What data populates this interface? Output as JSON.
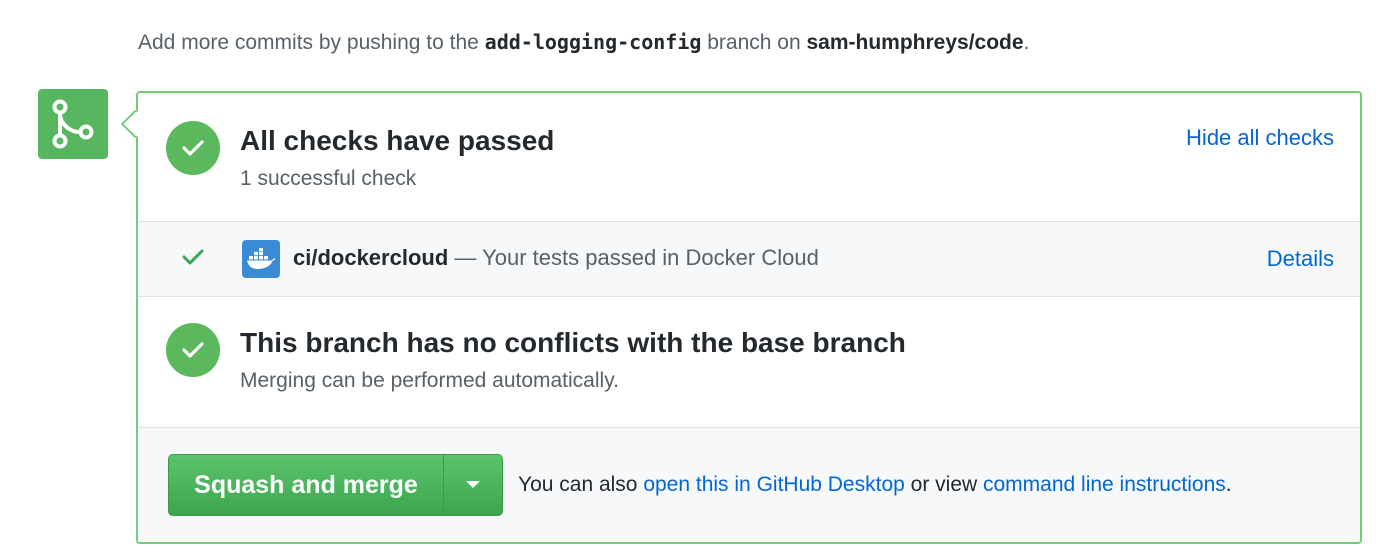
{
  "hint": {
    "prefix": "Add more commits by pushing to the ",
    "branch": "add-logging-config",
    "middle": " branch on ",
    "repo": "sam-humphreys/code",
    "suffix": "."
  },
  "checks": {
    "title": "All checks have passed",
    "subtitle": "1 successful check",
    "toggle_label": "Hide all checks",
    "items": [
      {
        "context": "ci/dockercloud",
        "separator": " — ",
        "description": "Your tests passed in Docker Cloud",
        "details_label": "Details",
        "icon": "docker-logo-icon"
      }
    ]
  },
  "conflicts": {
    "title": "This branch has no conflicts with the base branch",
    "subtitle": "Merging can be performed automatically."
  },
  "merge": {
    "button_label": "Squash and merge",
    "text_prefix": "You can also ",
    "desktop_link": "open this in GitHub Desktop",
    "text_middle": " or view ",
    "cli_link": "command line instructions",
    "text_suffix": "."
  },
  "colors": {
    "success_green": "#5cb85c",
    "border_green": "#6fcf75",
    "link_blue": "#0366d6",
    "button_green": "#3ea54e"
  }
}
